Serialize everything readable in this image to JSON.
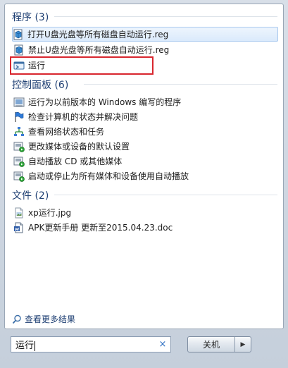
{
  "programs": {
    "header": "程序 (3)",
    "items": [
      {
        "label": "打开U盘光盘等所有磁盘自动运行.reg",
        "icon": "reg-file-icon"
      },
      {
        "label": "禁止U盘光盘等所有磁盘自动运行.reg",
        "icon": "reg-file-icon"
      },
      {
        "label": "运行",
        "icon": "run-icon"
      }
    ]
  },
  "control_panel": {
    "header": "控制面板 (6)",
    "items": [
      {
        "label": "运行为以前版本的 Windows 编写的程序",
        "icon": "compat-icon"
      },
      {
        "label": "检查计算机的状态并解决问题",
        "icon": "flag-icon"
      },
      {
        "label": "查看网络状态和任务",
        "icon": "network-icon"
      },
      {
        "label": "更改媒体或设备的默认设置",
        "icon": "autoplay-icon"
      },
      {
        "label": "自动播放 CD 或其他媒体",
        "icon": "autoplay-icon"
      },
      {
        "label": "启动或停止为所有媒体和设备使用自动播放",
        "icon": "autoplay-icon"
      }
    ]
  },
  "files": {
    "header": "文件 (2)",
    "items": [
      {
        "label": "xp运行.jpg",
        "icon": "jpg-file-icon"
      },
      {
        "label": "APK更新手册 更新至2015.04.23.doc",
        "icon": "doc-file-icon"
      }
    ]
  },
  "more_results": "查看更多结果",
  "search": {
    "value": "运行",
    "clear_glyph": "×"
  },
  "shutdown": {
    "label": "关机",
    "arrow": "▶"
  },
  "colors": {
    "section_header": "#1e3f73",
    "highlight_border": "#d8262e",
    "selection_bg": "#dbeafc"
  }
}
